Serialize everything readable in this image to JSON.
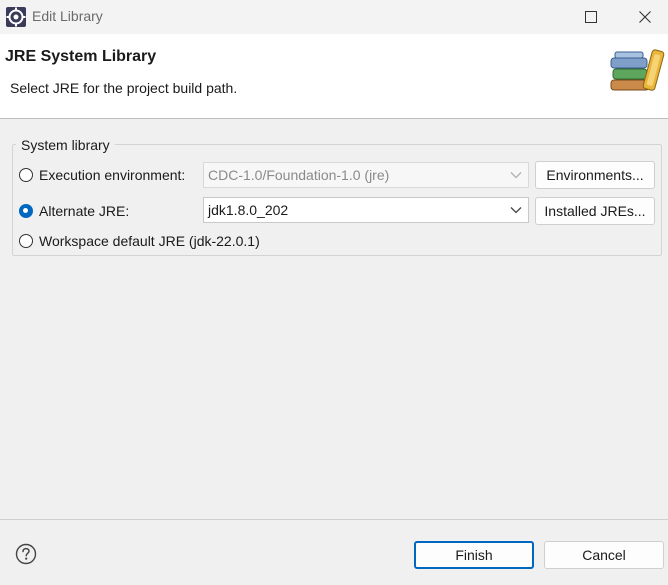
{
  "window": {
    "title": "Edit Library",
    "app_icon": "eclipse-icon",
    "controls": [
      "maximize-icon",
      "close-icon"
    ]
  },
  "header": {
    "title": "JRE System Library",
    "description": "Select JRE for the project build path.",
    "image": "library-books-icon"
  },
  "system_library": {
    "group_label": "System library",
    "options": [
      {
        "label": "Execution environment:",
        "selected": false
      },
      {
        "label": "Alternate JRE:",
        "selected": true
      },
      {
        "label": "Workspace default JRE (jdk-22.0.1)",
        "selected": false
      }
    ],
    "execution_environment_value": "CDC-1.0/Foundation-1.0 (jre)",
    "alternate_jre_value": "jdk1.8.0_202",
    "environments_button": "Environments...",
    "installed_jres_button": "Installed JREs..."
  },
  "footer": {
    "help_icon": "help-icon",
    "finish_button": "Finish",
    "cancel_button": "Cancel"
  },
  "colors": {
    "accent": "#0067c0",
    "header_background": "#ffffff",
    "dialog_background": "#f0f0f0"
  }
}
